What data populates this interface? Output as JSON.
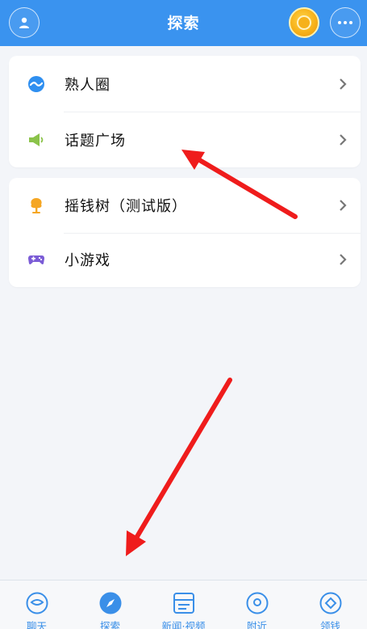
{
  "header": {
    "title": "探索",
    "avatar_icon": "user-icon",
    "coin_icon": "coin-icon",
    "more_icon": "more-icon"
  },
  "menu_groups": [
    {
      "items": [
        {
          "label": "熟人圈",
          "icon": "acquaintance-circle-icon",
          "color": "#2f8ff0"
        },
        {
          "label": "话题广场",
          "icon": "megaphone-icon",
          "color": "#8bc34a"
        }
      ]
    },
    {
      "items": [
        {
          "label": "摇钱树（测试版）",
          "icon": "money-tree-icon",
          "color": "#f5a623"
        },
        {
          "label": "小游戏",
          "icon": "gamepad-icon",
          "color": "#7b5cd6"
        }
      ]
    }
  ],
  "tabbar": {
    "tabs": [
      {
        "label": "聊天",
        "icon": "chat-icon",
        "active": false
      },
      {
        "label": "探索",
        "icon": "compass-icon",
        "active": true
      },
      {
        "label": "新闻·视频",
        "icon": "news-icon",
        "active": false
      },
      {
        "label": "附近",
        "icon": "location-icon",
        "active": false
      },
      {
        "label": "领钱",
        "icon": "coin-diamond-icon",
        "active": false
      }
    ]
  },
  "colors": {
    "header": "#3a93ef",
    "accent": "#3a8fe8",
    "annotation_arrow": "#ef1c1c"
  }
}
